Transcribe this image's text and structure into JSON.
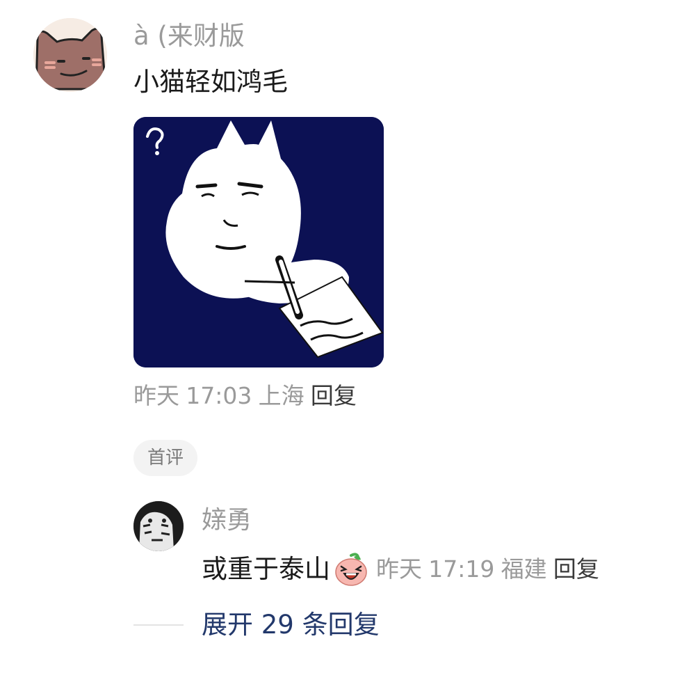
{
  "comment": {
    "username": "à (来财版",
    "text": "小猫轻如鸿毛",
    "meta": {
      "date": "昨天",
      "time": "17:03",
      "location": "上海",
      "reply_label": "回复"
    },
    "badge": "首评",
    "avatar_icon": "cat-avatar-icon",
    "sticker_icon": "cat-writing-sticker",
    "colors": {
      "sticker_bg": "#0c1154",
      "avatar_cat": "#9e6f68"
    }
  },
  "reply": {
    "username": "媇勇",
    "text": "或重于泰山",
    "emoji_icon": "laughing-peach-emoji",
    "meta": {
      "date": "昨天",
      "time": "17:19",
      "location": "福建",
      "reply_label": "回复"
    }
  },
  "expand": {
    "label": "展开 29 条回复"
  }
}
